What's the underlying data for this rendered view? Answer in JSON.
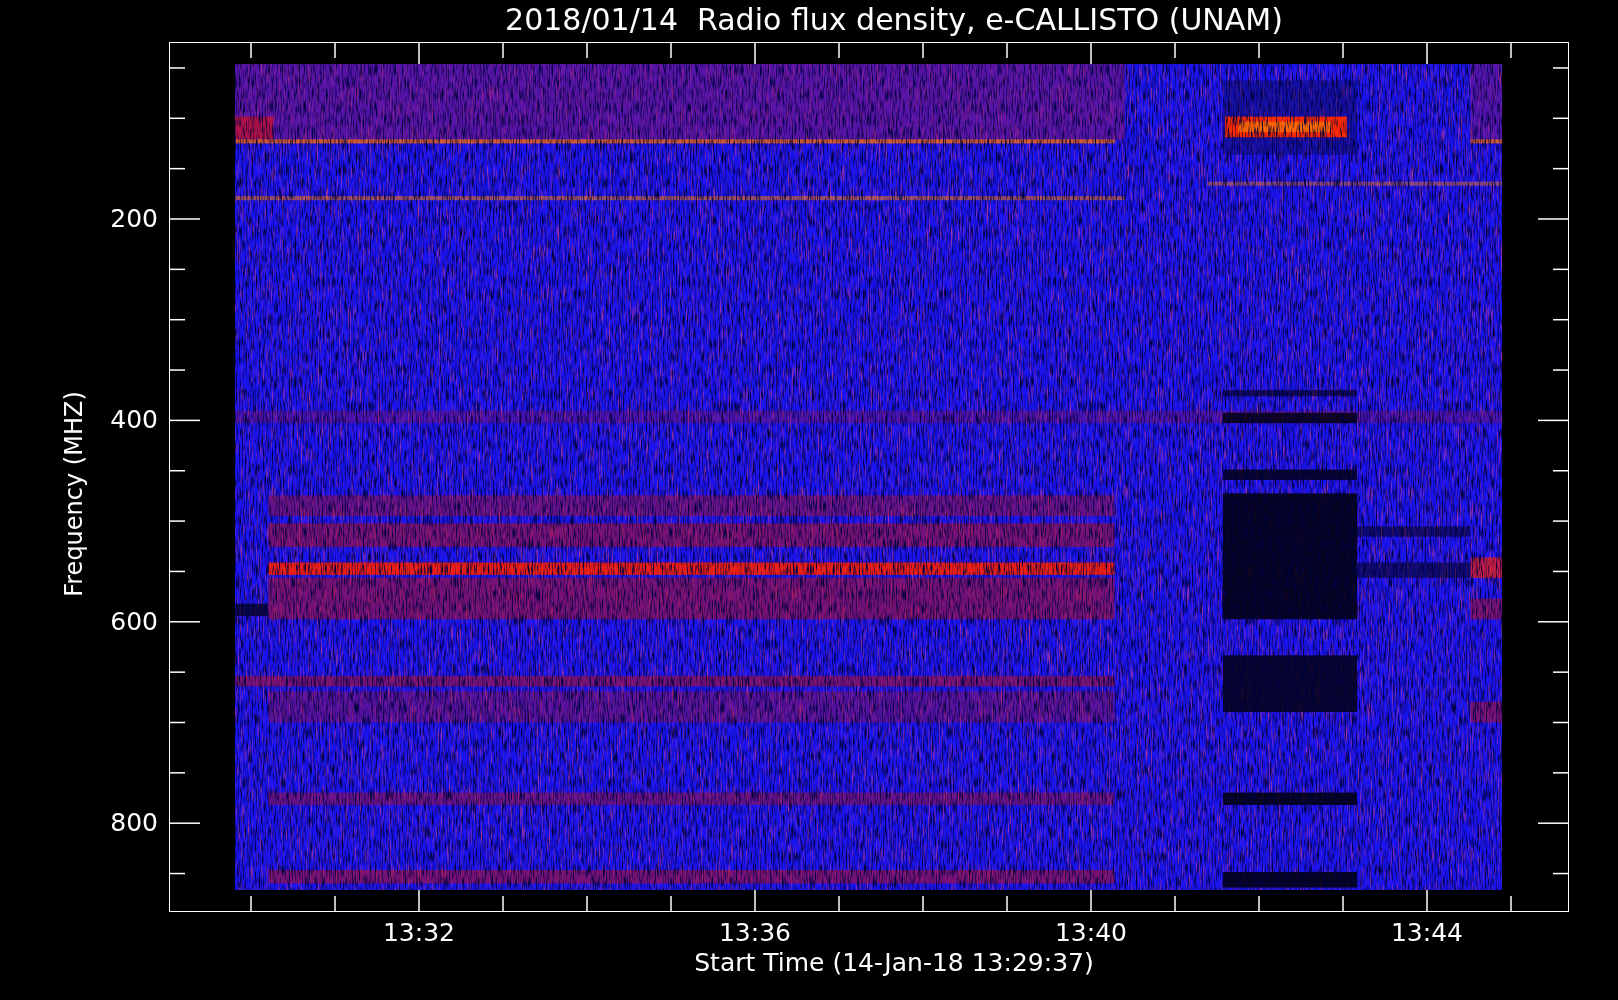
{
  "title": "2018/01/14  Radio flux density, e-CALLISTO (UNAM)",
  "y_axis": {
    "label": "Frequency (MHZ)",
    "ticks": [
      "200",
      "400",
      "600",
      "800"
    ]
  },
  "x_axis": {
    "label": "Start Time (14-Jan-18 13:29:37)",
    "ticks": [
      "13:32",
      "13:36",
      "13:40",
      "13:44"
    ]
  }
}
